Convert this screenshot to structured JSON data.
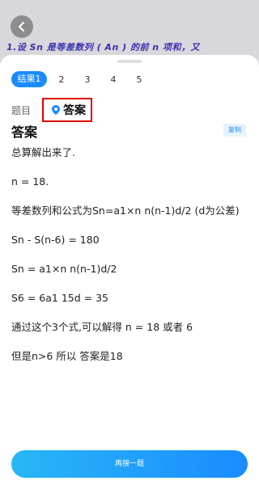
{
  "photo": {
    "text": "1.设 Sn 是等差数列 ( An ) 的前 n 项和，又"
  },
  "tabs": [
    "结果1",
    "2",
    "3",
    "4",
    "5"
  ],
  "toggle": {
    "question_label": "题目",
    "answer_label": "答案"
  },
  "answer": {
    "title": "答案",
    "copy_label": "复制",
    "lines": [
      "总算解出来了.",
      "n = 18.",
      "等差数列和公式为Sn=a1×n n(n-1)d/2 (d为公差)",
      "Sn - S(n-6) = 180",
      "Sn = a1×n n(n-1)d/2",
      "S6 = 6a1 15d = 35",
      "通过这个3个式,可以解得 n = 18 或者 6",
      "但是n>6 所以 答案是18"
    ]
  },
  "footer": {
    "search_again_label": "再搜一题"
  },
  "colors": {
    "accent": "#1a8cff",
    "highlight_border": "#e00000"
  }
}
